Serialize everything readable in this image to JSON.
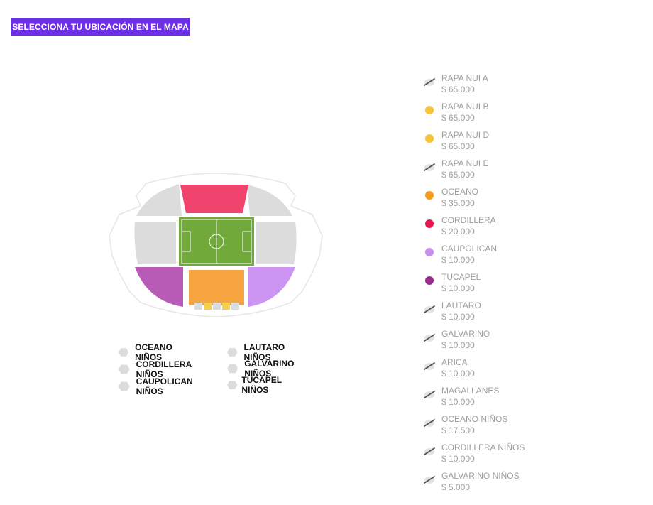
{
  "header": {
    "select_location_label": "SELECCIONA TU UBICACIÓN EN EL MAPA"
  },
  "map": {
    "sectors": [
      {
        "id": "cordillera",
        "color": "#f0436e"
      },
      {
        "id": "oceano",
        "color": "#f7a541"
      },
      {
        "id": "tucapel",
        "color": "#b95cb8"
      },
      {
        "id": "caupolican",
        "color": "#cc95f2"
      },
      {
        "id": "rapa-nui",
        "color": "#f5d04a"
      },
      {
        "id": "unavailable",
        "color": "#dcdcdc"
      },
      {
        "id": "field",
        "color": "#71a93b"
      }
    ]
  },
  "kids_legend": [
    {
      "label": "OCEANO NIÑOS",
      "icon": "hexagon-icon"
    },
    {
      "label": "CORDILLERA NIÑOS",
      "icon": "hexagon-icon"
    },
    {
      "label": "CAUPOLICAN NIÑOS",
      "icon": "hexagon-icon"
    },
    {
      "label": "LAUTARO NIÑOS",
      "icon": "hexagon-icon"
    },
    {
      "label": "GALVARINO NIÑOS",
      "icon": "hexagon-icon"
    },
    {
      "label": "TUCAPEL NIÑOS",
      "icon": "hexagon-icon"
    }
  ],
  "prices": [
    {
      "name": "RAPA NUI A",
      "price": "$ 65.000",
      "icon": "sold-out-icon"
    },
    {
      "name": "RAPA NUI B",
      "price": "$ 65.000",
      "icon": "dot-icon",
      "color": "#f5c63a"
    },
    {
      "name": "RAPA NUI D",
      "price": "$ 65.000",
      "icon": "dot-icon",
      "color": "#f5c63a"
    },
    {
      "name": "RAPA NUI E",
      "price": "$ 65.000",
      "icon": "sold-out-icon"
    },
    {
      "name": "OCEANO",
      "price": "$ 35.000",
      "icon": "dot-icon",
      "color": "#f59b1a"
    },
    {
      "name": "CORDILLERA",
      "price": "$ 20.000",
      "icon": "dot-icon",
      "color": "#e8154f"
    },
    {
      "name": "CAUPOLICAN",
      "price": "$ 10.000",
      "icon": "dot-icon",
      "color": "#c68ff0"
    },
    {
      "name": "TUCAPEL",
      "price": "$ 10.000",
      "icon": "dot-icon",
      "color": "#9b2a8f"
    },
    {
      "name": "LAUTARO",
      "price": "$ 10.000",
      "icon": "sold-out-icon"
    },
    {
      "name": "GALVARINO",
      "price": "$ 10.000",
      "icon": "sold-out-icon"
    },
    {
      "name": "ARICA",
      "price": "$ 10.000",
      "icon": "sold-out-icon"
    },
    {
      "name": "MAGALLANES",
      "price": "$ 10.000",
      "icon": "sold-out-icon"
    },
    {
      "name": "OCEANO NIÑOS",
      "price": "$ 17.500",
      "icon": "sold-out-icon"
    },
    {
      "name": "CORDILLERA NIÑOS",
      "price": "$ 10.000",
      "icon": "sold-out-icon"
    },
    {
      "name": "GALVARINO NIÑOS",
      "price": "$ 5.000",
      "icon": "sold-out-icon"
    }
  ]
}
